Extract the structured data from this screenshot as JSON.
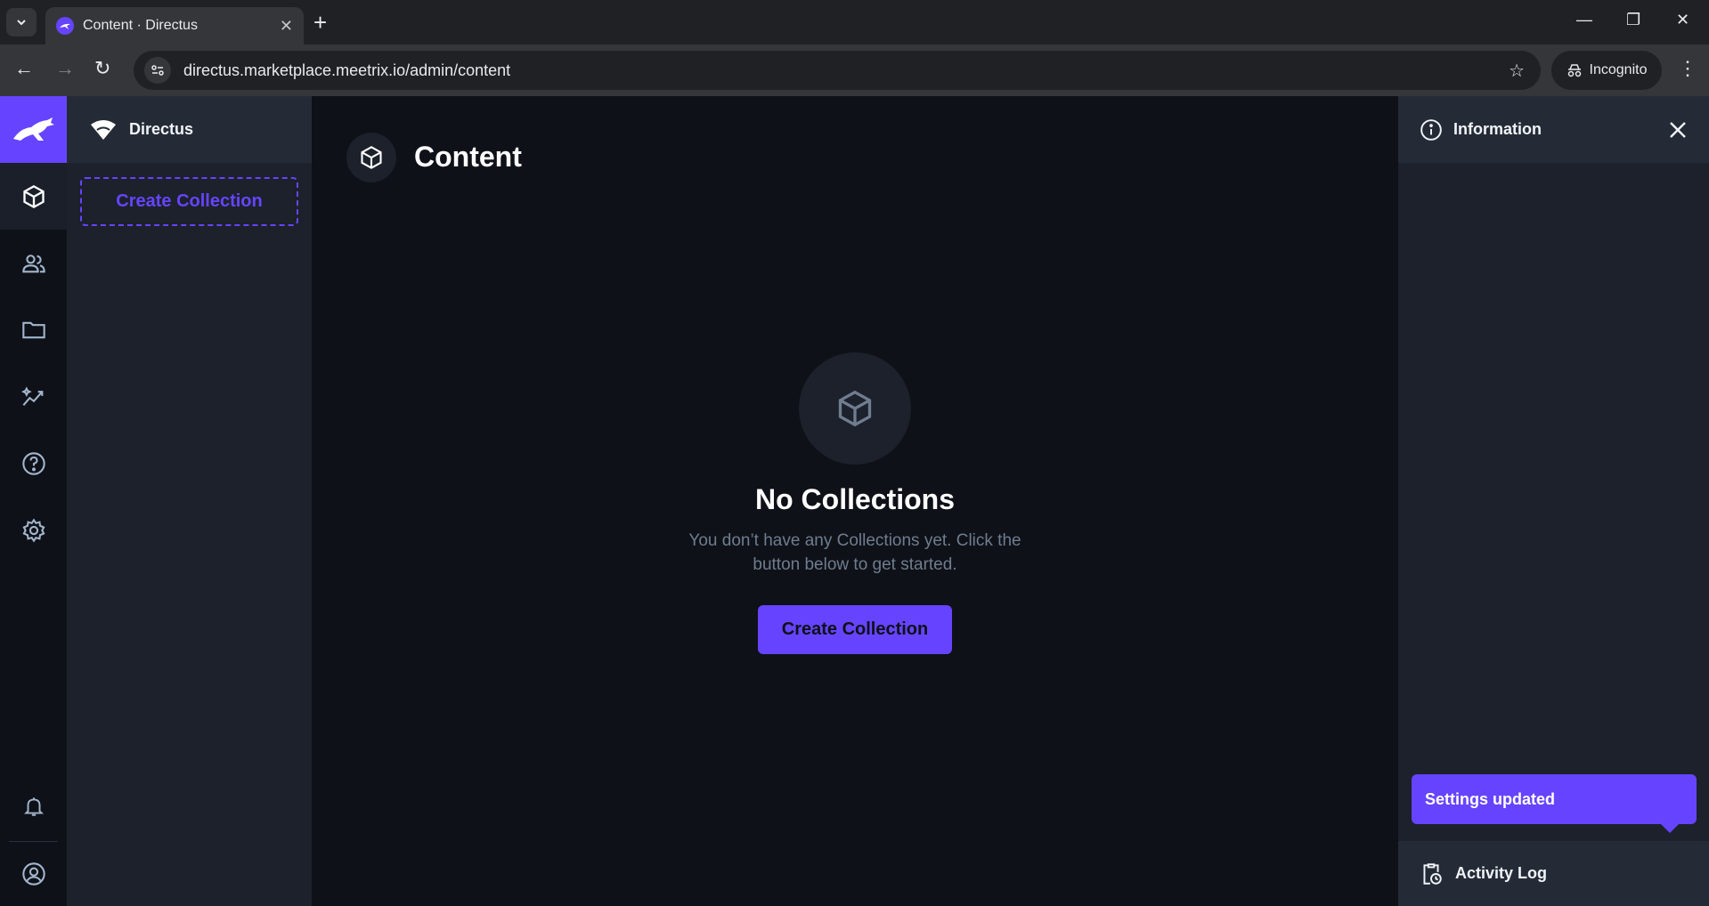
{
  "browser": {
    "tab_title": "Content · Directus",
    "url": "directus.marketplace.meetrix.io/admin/content",
    "incognito_label": "Incognito"
  },
  "project": {
    "name": "Directus"
  },
  "nav": {
    "create_collection_label": "Create Collection"
  },
  "header": {
    "title": "Content"
  },
  "empty_state": {
    "title": "No Collections",
    "text": "You don’t have any Collections yet. Click the button below to get started.",
    "button_label": "Create Collection"
  },
  "sidebar": {
    "info_title": "Information",
    "activity_label": "Activity Log"
  },
  "notification": {
    "text": "Settings updated"
  },
  "colors": {
    "accent": "#6644ff",
    "background": "#0e1117",
    "panel": "#1c212b"
  }
}
